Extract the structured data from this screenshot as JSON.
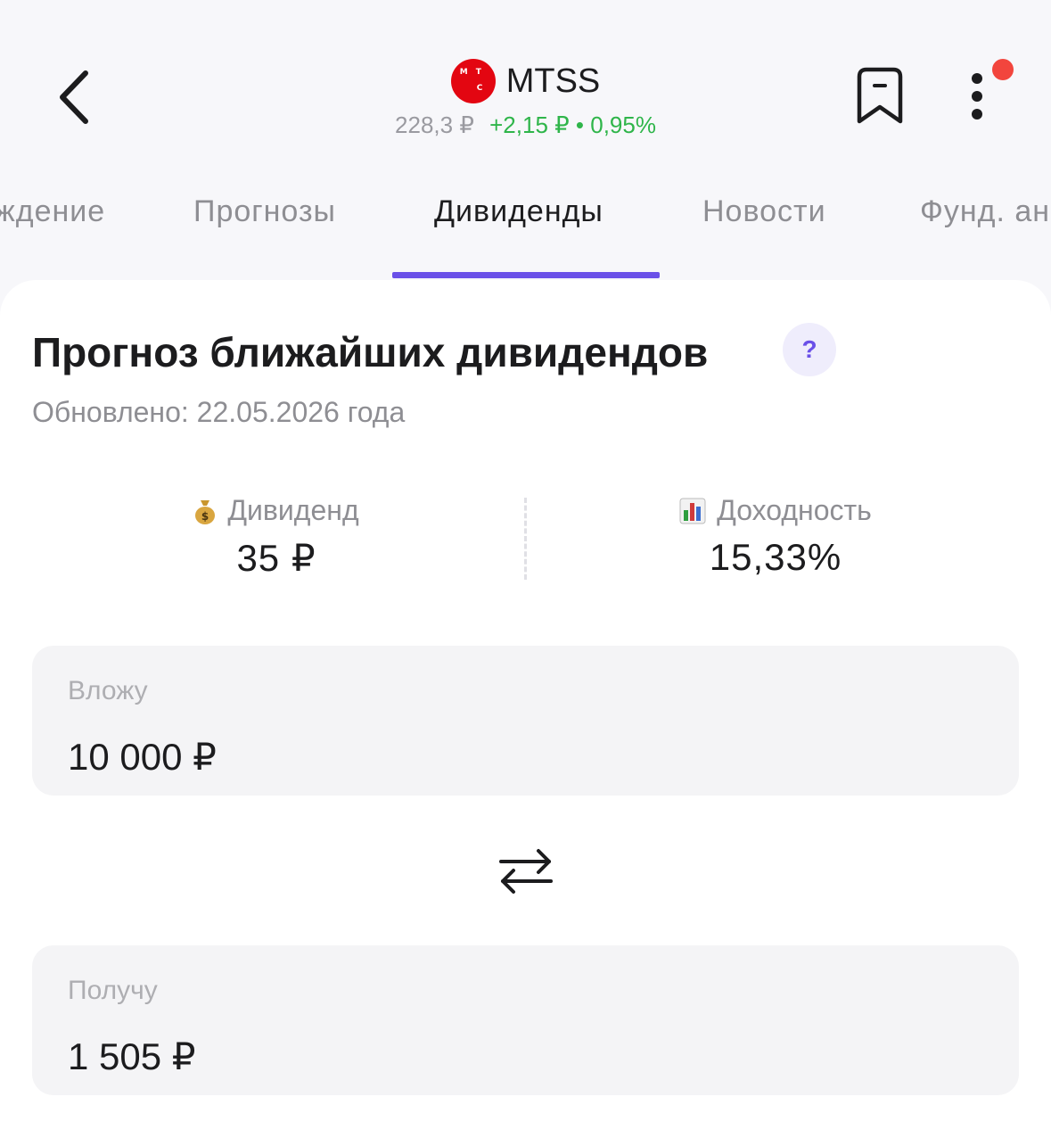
{
  "header": {
    "logo_letters": [
      "М",
      "Т",
      "С"
    ],
    "ticker": "MTSS",
    "price": "228,3 ₽",
    "change": "+2,15 ₽ • 0,95%",
    "logo_color": "#e30611",
    "change_color": "#2fb54a",
    "notification_color": "#f2453d"
  },
  "tabs": [
    {
      "label": "ждение"
    },
    {
      "label": "Прогнозы"
    },
    {
      "label": "Дивиденды",
      "active": true
    },
    {
      "label": "Новости"
    },
    {
      "label": "Фунд. ан"
    }
  ],
  "accent_color": "#6a50e8",
  "card": {
    "title": "Прогноз ближайших дивидендов",
    "help_label": "?",
    "updated": "Обновлено: 22.05.2026 года",
    "dividend": {
      "icon": "money-bag-icon",
      "label": "Дивиденд",
      "value": "35 ₽"
    },
    "yield": {
      "icon": "bar-chart-icon",
      "label": "Доходность",
      "value": "15,33%"
    },
    "invest": {
      "label": "Вложу",
      "value": "10 000 ₽"
    },
    "receive": {
      "label": "Получу",
      "value": "1 505 ₽"
    }
  }
}
